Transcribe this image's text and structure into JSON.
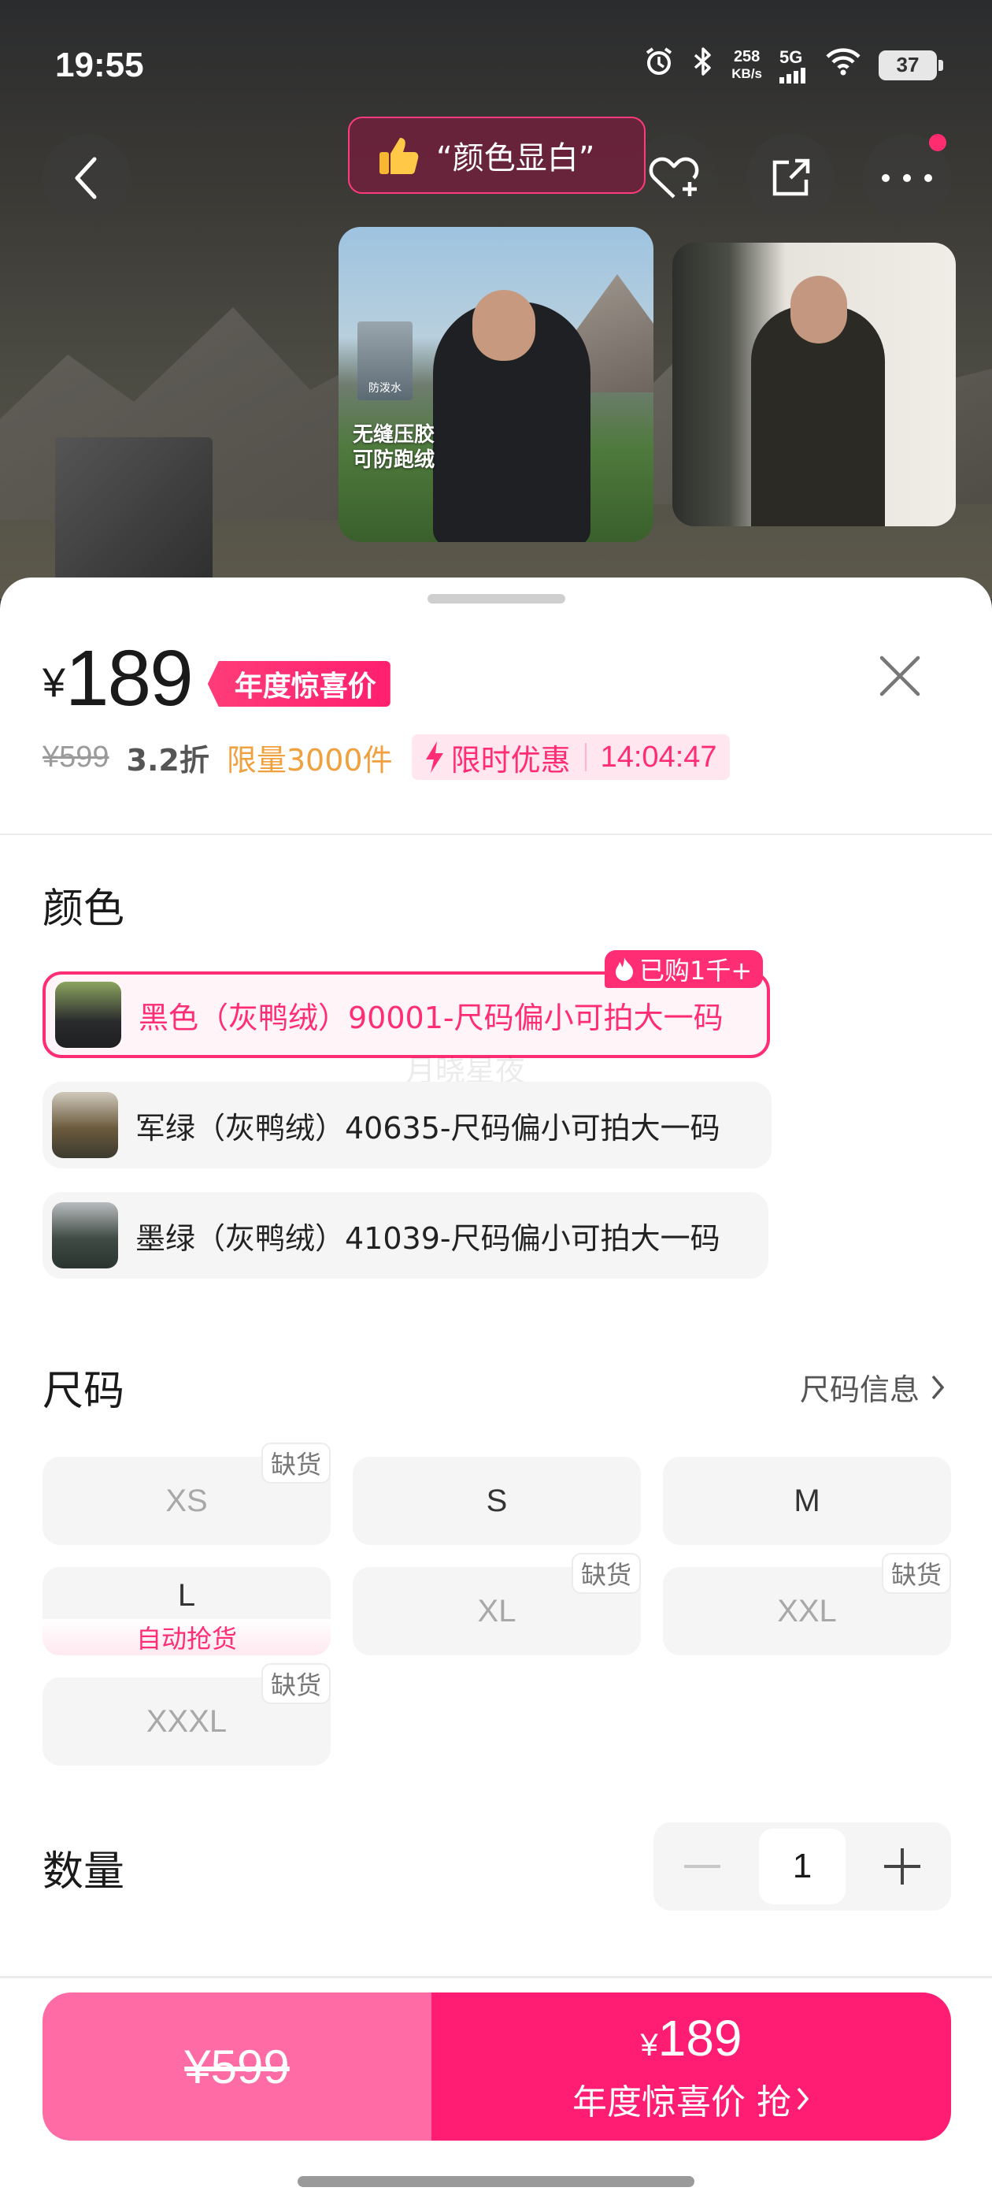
{
  "status_bar": {
    "time": "19:55",
    "net_speed_value": "258",
    "net_speed_unit": "KB/s",
    "signal_label": "5G",
    "battery": "37",
    "icons": [
      "alarm-icon",
      "bluetooth-icon",
      "signal-icon",
      "wifi-icon",
      "battery-icon"
    ]
  },
  "header": {
    "tag_text": "“颜色显白”",
    "icons": [
      "back-icon",
      "heart-add-icon",
      "share-icon",
      "more-icon"
    ]
  },
  "gallery": {
    "photo1_badge": "防泼水",
    "photo1_caption_line1": "无缝压胶",
    "photo1_caption_line2": "可防跑绒"
  },
  "price": {
    "currency": "¥",
    "amount": "189",
    "tag": "年度惊喜价",
    "original": "¥599",
    "discount": "3.2折",
    "limit": "限量3000件",
    "flash_label": "限时优惠",
    "countdown": "14:04:47"
  },
  "colors": {
    "title": "颜色",
    "bought_badge": "已购1千+",
    "watermark": "月晓星夜",
    "options": [
      {
        "label": "黑色（灰鸭绒）90001-尺码偏小可拍大一码",
        "selected": true
      },
      {
        "label": "军绿（灰鸭绒）40635-尺码偏小可拍大一码",
        "selected": false
      },
      {
        "label": "墨绿（灰鸭绒）41039-尺码偏小可拍大一码",
        "selected": false
      }
    ]
  },
  "sizes": {
    "title": "尺码",
    "info_link": "尺码信息",
    "oos_label": "缺货",
    "auto_label": "自动抢货",
    "options": [
      {
        "label": "XS",
        "out_of_stock": true
      },
      {
        "label": "S",
        "out_of_stock": false
      },
      {
        "label": "M",
        "out_of_stock": false
      },
      {
        "label": "L",
        "out_of_stock": false,
        "auto_grab": true
      },
      {
        "label": "XL",
        "out_of_stock": true
      },
      {
        "label": "XXL",
        "out_of_stock": true
      },
      {
        "label": "XXXL",
        "out_of_stock": true
      }
    ]
  },
  "quantity": {
    "title": "数量",
    "value": "1"
  },
  "buy_bar": {
    "original_price": "¥599",
    "price_currency": "¥",
    "price_amount": "189",
    "action_label": "年度惊喜价 抢"
  },
  "colors_theme": {
    "accent": "#ff2e74",
    "orange": "#f0a03c",
    "buy_left": "#ff6ba5",
    "buy_right": "#ff1d73"
  }
}
